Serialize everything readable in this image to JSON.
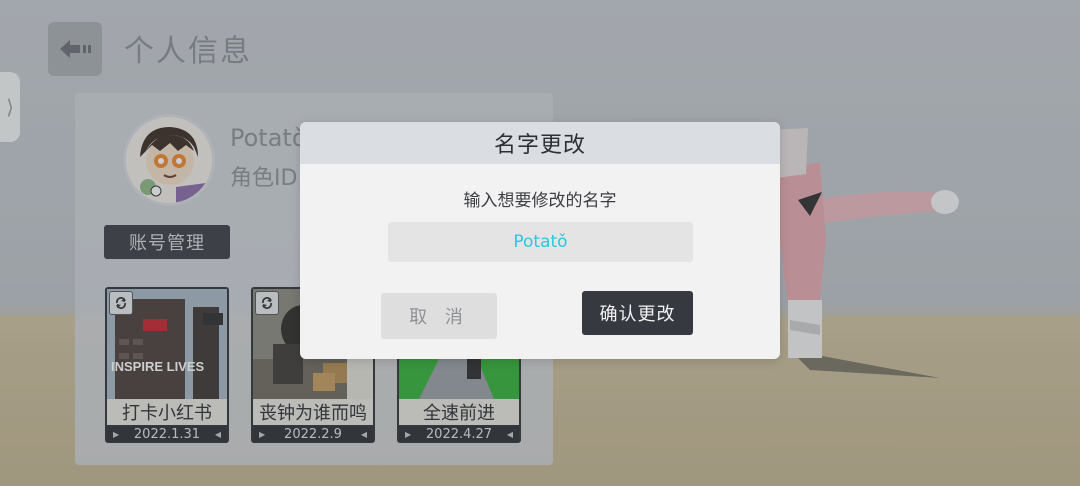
{
  "header": {
    "title": "个人信息",
    "back_icon": "back-arrow-icon"
  },
  "side_tab": {
    "icon": "chevron-right-icon",
    "glyph": "⟩"
  },
  "profile": {
    "name": "Potatǒ",
    "id_label": "角色ID:",
    "account_button": "账号管理"
  },
  "cards": [
    {
      "title": "打卡小红书",
      "date": "2022.1.31"
    },
    {
      "title": "丧钟为谁而鸣",
      "date": "2022.2.9"
    },
    {
      "title": "全速前进",
      "date": "2022.4.27"
    }
  ],
  "card_thumb_text": {
    "banner": "INSPIRE LIVES",
    "logo": "小红书"
  },
  "modal": {
    "title": "名字更改",
    "prompt": "输入想要修改的名字",
    "input_value": "Potatǒ",
    "cancel": "取 消",
    "confirm": "确认更改"
  },
  "colors": {
    "input_text": "#29c7e0",
    "confirm_bg": "#363a40",
    "header_bg": "#dadde2"
  }
}
